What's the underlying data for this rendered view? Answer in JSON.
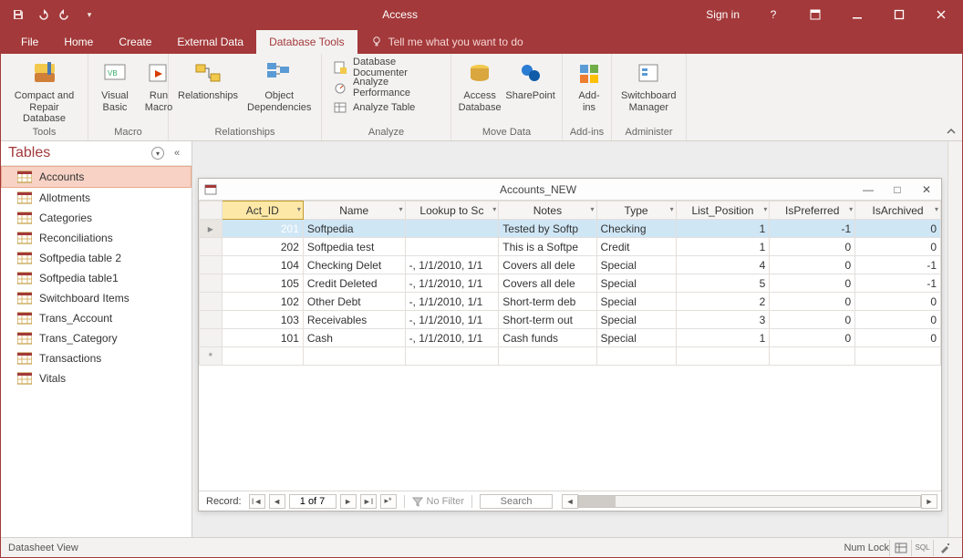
{
  "titlebar": {
    "app": "Access",
    "signin": "Sign in"
  },
  "tabs": {
    "file": "File",
    "home": "Home",
    "create": "Create",
    "external": "External Data",
    "dbtools": "Database Tools",
    "tell": "Tell me what you want to do"
  },
  "ribbon": {
    "tools": {
      "compact": "Compact and\nRepair Database",
      "group": "Tools"
    },
    "macro": {
      "visual": "Visual\nBasic",
      "run": "Run\nMacro",
      "group": "Macro"
    },
    "rel": {
      "relationships": "Relationships",
      "objdep": "Object\nDependencies",
      "group": "Relationships"
    },
    "analyze": {
      "doc": "Database Documenter",
      "perf": "Analyze Performance",
      "table": "Analyze Table",
      "group": "Analyze"
    },
    "move": {
      "access": "Access\nDatabase",
      "sharepoint": "SharePoint",
      "group": "Move Data"
    },
    "addins": {
      "addins": "Add-\nins",
      "group": "Add-ins"
    },
    "admin": {
      "switchboard": "Switchboard\nManager",
      "group": "Administer"
    }
  },
  "nav": {
    "header": "Tables",
    "items": [
      "Accounts",
      "Allotments",
      "Categories",
      "Reconciliations",
      "Softpedia table 2",
      "Softpedia table1",
      "Switchboard Items",
      "Trans_Account",
      "Trans_Category",
      "Transactions",
      "Vitals"
    ],
    "selected": 0
  },
  "subwin": {
    "title": "Accounts_NEW"
  },
  "columns": [
    "Act_ID",
    "Name",
    "Lookup to Sc",
    "Notes",
    "Type",
    "List_Position",
    "IsPreferred",
    "IsArchived"
  ],
  "rows": [
    {
      "id": "201",
      "name": "Softpedia",
      "lookup": "",
      "notes": "Tested by Softp",
      "type": "Checking",
      "pos": "1",
      "pref": "-1",
      "arch": "0"
    },
    {
      "id": "202",
      "name": "Softpedia test",
      "lookup": "",
      "notes": "This is a Softpe",
      "type": "Credit",
      "pos": "1",
      "pref": "0",
      "arch": "0"
    },
    {
      "id": "104",
      "name": "Checking Delet",
      "lookup": "-, 1/1/2010, 1/1",
      "notes": "Covers all dele",
      "type": "Special",
      "pos": "4",
      "pref": "0",
      "arch": "-1"
    },
    {
      "id": "105",
      "name": "Credit Deleted",
      "lookup": "-, 1/1/2010, 1/1",
      "notes": "Covers all dele",
      "type": "Special",
      "pos": "5",
      "pref": "0",
      "arch": "-1"
    },
    {
      "id": "102",
      "name": "Other Debt",
      "lookup": "-, 1/1/2010, 1/1",
      "notes": "Short-term deb",
      "type": "Special",
      "pos": "2",
      "pref": "0",
      "arch": "0"
    },
    {
      "id": "103",
      "name": "Receivables",
      "lookup": "-, 1/1/2010, 1/1",
      "notes": "Short-term out",
      "type": "Special",
      "pos": "3",
      "pref": "0",
      "arch": "0"
    },
    {
      "id": "101",
      "name": "Cash",
      "lookup": "-, 1/1/2010, 1/1",
      "notes": "Cash funds",
      "type": "Special",
      "pos": "1",
      "pref": "0",
      "arch": "0"
    }
  ],
  "recnav": {
    "label": "Record:",
    "pos": "1 of 7",
    "nofilter": "No Filter",
    "search": "Search"
  },
  "status": {
    "view": "Datasheet View",
    "numlock": "Num Lock"
  }
}
